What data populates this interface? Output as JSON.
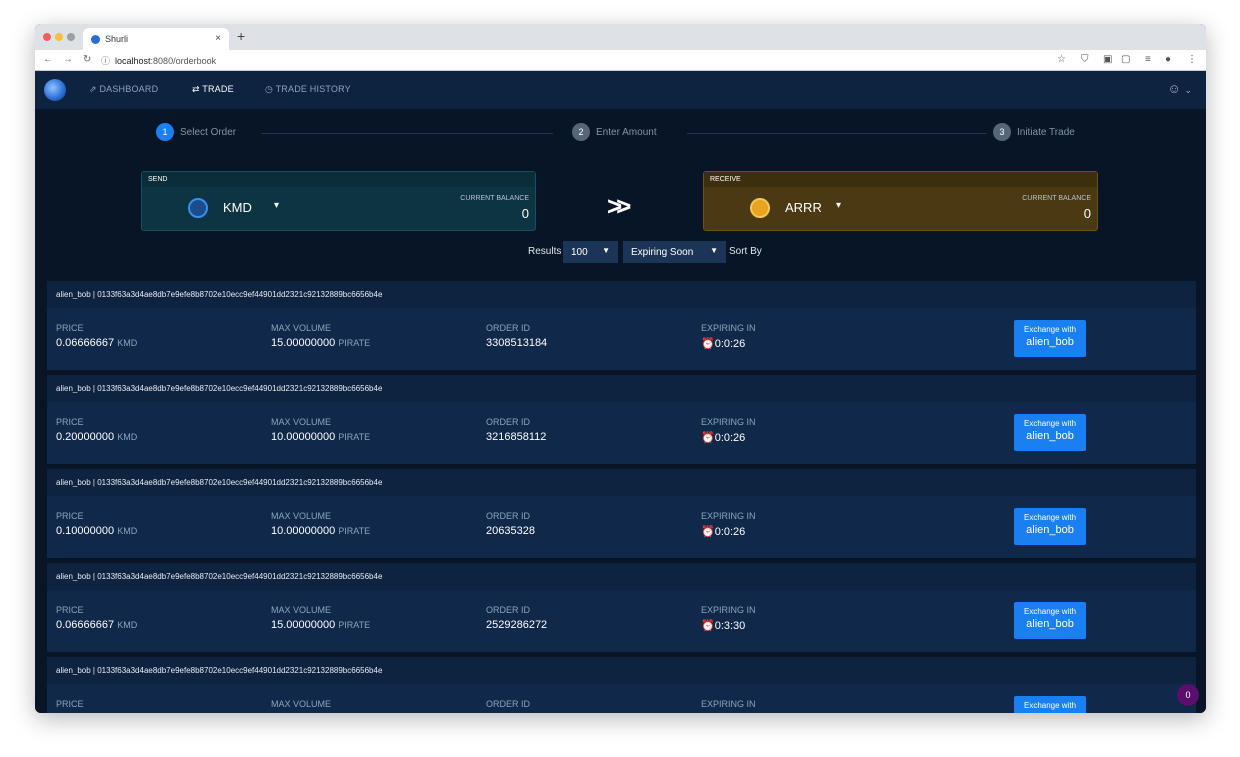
{
  "browser": {
    "tab_title": "Shurli",
    "tab_close": "×",
    "new_tab": "+",
    "url_host": "localhost",
    "url_path": ":8080/orderbook",
    "traffic_lights": [
      "#f25f58",
      "#fbbe3e",
      "#58c73f"
    ]
  },
  "nav": {
    "items": [
      {
        "label": "DASHBOARD",
        "icon": "rocket-icon"
      },
      {
        "label": "TRADE",
        "icon": "swap-arrows-icon"
      },
      {
        "label": "TRADE HISTORY",
        "icon": "history-icon"
      }
    ],
    "active": "TRADE"
  },
  "stepper": {
    "steps": [
      {
        "num": "1",
        "label": "Select Order"
      },
      {
        "num": "2",
        "label": "Enter Amount"
      },
      {
        "num": "3",
        "label": "Initiate Trade"
      }
    ]
  },
  "send": {
    "header": "SEND",
    "coin": "KMD",
    "balance_label": "CURRENT BALANCE",
    "balance": "0",
    "color": "#0e3a4a"
  },
  "receive": {
    "header": "RECEIVE",
    "coin": "ARRR",
    "balance_label": "CURRENT BALANCE",
    "balance": "0",
    "color": "#4a3a10"
  },
  "filters": {
    "results_label": "Results",
    "results_value": "100",
    "sort_value": "Expiring Soon",
    "sort_label": "Sort By"
  },
  "columns": {
    "price": "PRICE",
    "max_volume": "MAX VOLUME",
    "order_id": "ORDER ID",
    "expiring": "EXPIRING IN"
  },
  "orders": [
    {
      "maker": "alien_bob | 0133f63a3d4ae8db7e9efe8b8702e10ecc9ef44901dd2321c92132889bc6656b4e",
      "price": "0.06666667",
      "price_unit": "KMD",
      "volume": "15.00000000",
      "volume_unit": "PIRATE",
      "order_id": "3308513184",
      "expiring": "0:0:26",
      "btn_line1": "Exchange with",
      "btn_line2": "alien_bob"
    },
    {
      "maker": "alien_bob | 0133f63a3d4ae8db7e9efe8b8702e10ecc9ef44901dd2321c92132889bc6656b4e",
      "price": "0.20000000",
      "price_unit": "KMD",
      "volume": "10.00000000",
      "volume_unit": "PIRATE",
      "order_id": "3216858112",
      "expiring": "0:0:26",
      "btn_line1": "Exchange with",
      "btn_line2": "alien_bob"
    },
    {
      "maker": "alien_bob | 0133f63a3d4ae8db7e9efe8b8702e10ecc9ef44901dd2321c92132889bc6656b4e",
      "price": "0.10000000",
      "price_unit": "KMD",
      "volume": "10.00000000",
      "volume_unit": "PIRATE",
      "order_id": "20635328",
      "expiring": "0:0:26",
      "btn_line1": "Exchange with",
      "btn_line2": "alien_bob"
    },
    {
      "maker": "alien_bob | 0133f63a3d4ae8db7e9efe8b8702e10ecc9ef44901dd2321c92132889bc6656b4e",
      "price": "0.06666667",
      "price_unit": "KMD",
      "volume": "15.00000000",
      "volume_unit": "PIRATE",
      "order_id": "2529286272",
      "expiring": "0:3:30",
      "btn_line1": "Exchange with",
      "btn_line2": "alien_bob"
    },
    {
      "maker": "alien_bob | 0133f63a3d4ae8db7e9efe8b8702e10ecc9ef44901dd2321c92132889bc6656b4e",
      "price": "",
      "price_unit": "",
      "volume": "",
      "volume_unit": "",
      "order_id": "",
      "expiring": "",
      "btn_line1": "Exchange with",
      "btn_line2": ""
    }
  ],
  "notification_count": "0"
}
